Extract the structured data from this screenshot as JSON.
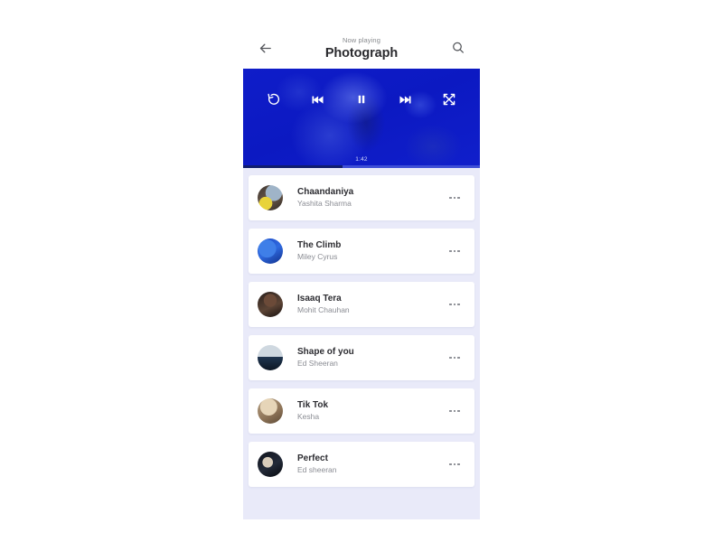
{
  "header": {
    "back_icon": "arrow-left-icon",
    "eyebrow": "Now playing",
    "title": "Photograph",
    "search_icon": "search-icon"
  },
  "player": {
    "background_color": "#0D1CC4",
    "elapsed_time": "1:42",
    "progress_percent": 42,
    "controls": [
      {
        "name": "replay-button",
        "icon": "replay-icon"
      },
      {
        "name": "previous-button",
        "icon": "skip-previous-icon"
      },
      {
        "name": "pause-button",
        "icon": "pause-icon"
      },
      {
        "name": "next-button",
        "icon": "skip-next-icon"
      },
      {
        "name": "shuffle-button",
        "icon": "shuffle-icon"
      }
    ]
  },
  "list": {
    "background_color": "#E9EAF9",
    "more_icon": "more-horizontal-icon",
    "tracks": [
      {
        "title": "Chaandaniya",
        "artist": "Yashita Sharma"
      },
      {
        "title": "The Climb",
        "artist": "Miley Cyrus"
      },
      {
        "title": "Isaaq Tera",
        "artist": "Mohit Chauhan"
      },
      {
        "title": "Shape of you",
        "artist": "Ed Sheeran"
      },
      {
        "title": "Tik Tok",
        "artist": "Kesha"
      },
      {
        "title": "Perfect",
        "artist": "Ed sheeran"
      }
    ]
  }
}
